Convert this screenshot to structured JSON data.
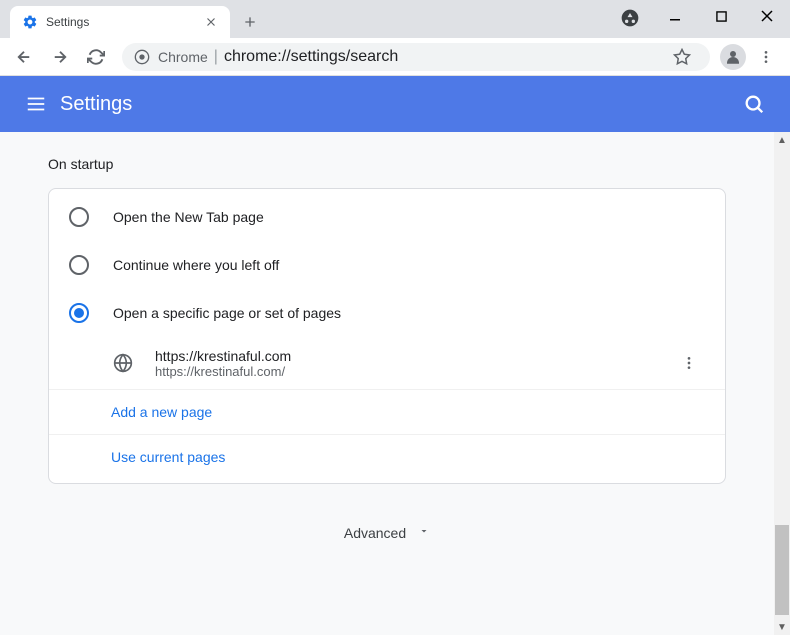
{
  "tab": {
    "title": "Settings"
  },
  "omnibox": {
    "scheme": "Chrome",
    "url": "chrome://settings/search"
  },
  "header": {
    "title": "Settings"
  },
  "section": {
    "title": "On startup"
  },
  "options": {
    "new_tab": "Open the New Tab page",
    "continue": "Continue where you left off",
    "specific": "Open a specific page or set of pages"
  },
  "page": {
    "title": "https://krestinaful.com",
    "url": "https://krestinaful.com/"
  },
  "links": {
    "add": "Add a new page",
    "use_current": "Use current pages"
  },
  "advanced": {
    "label": "Advanced"
  }
}
